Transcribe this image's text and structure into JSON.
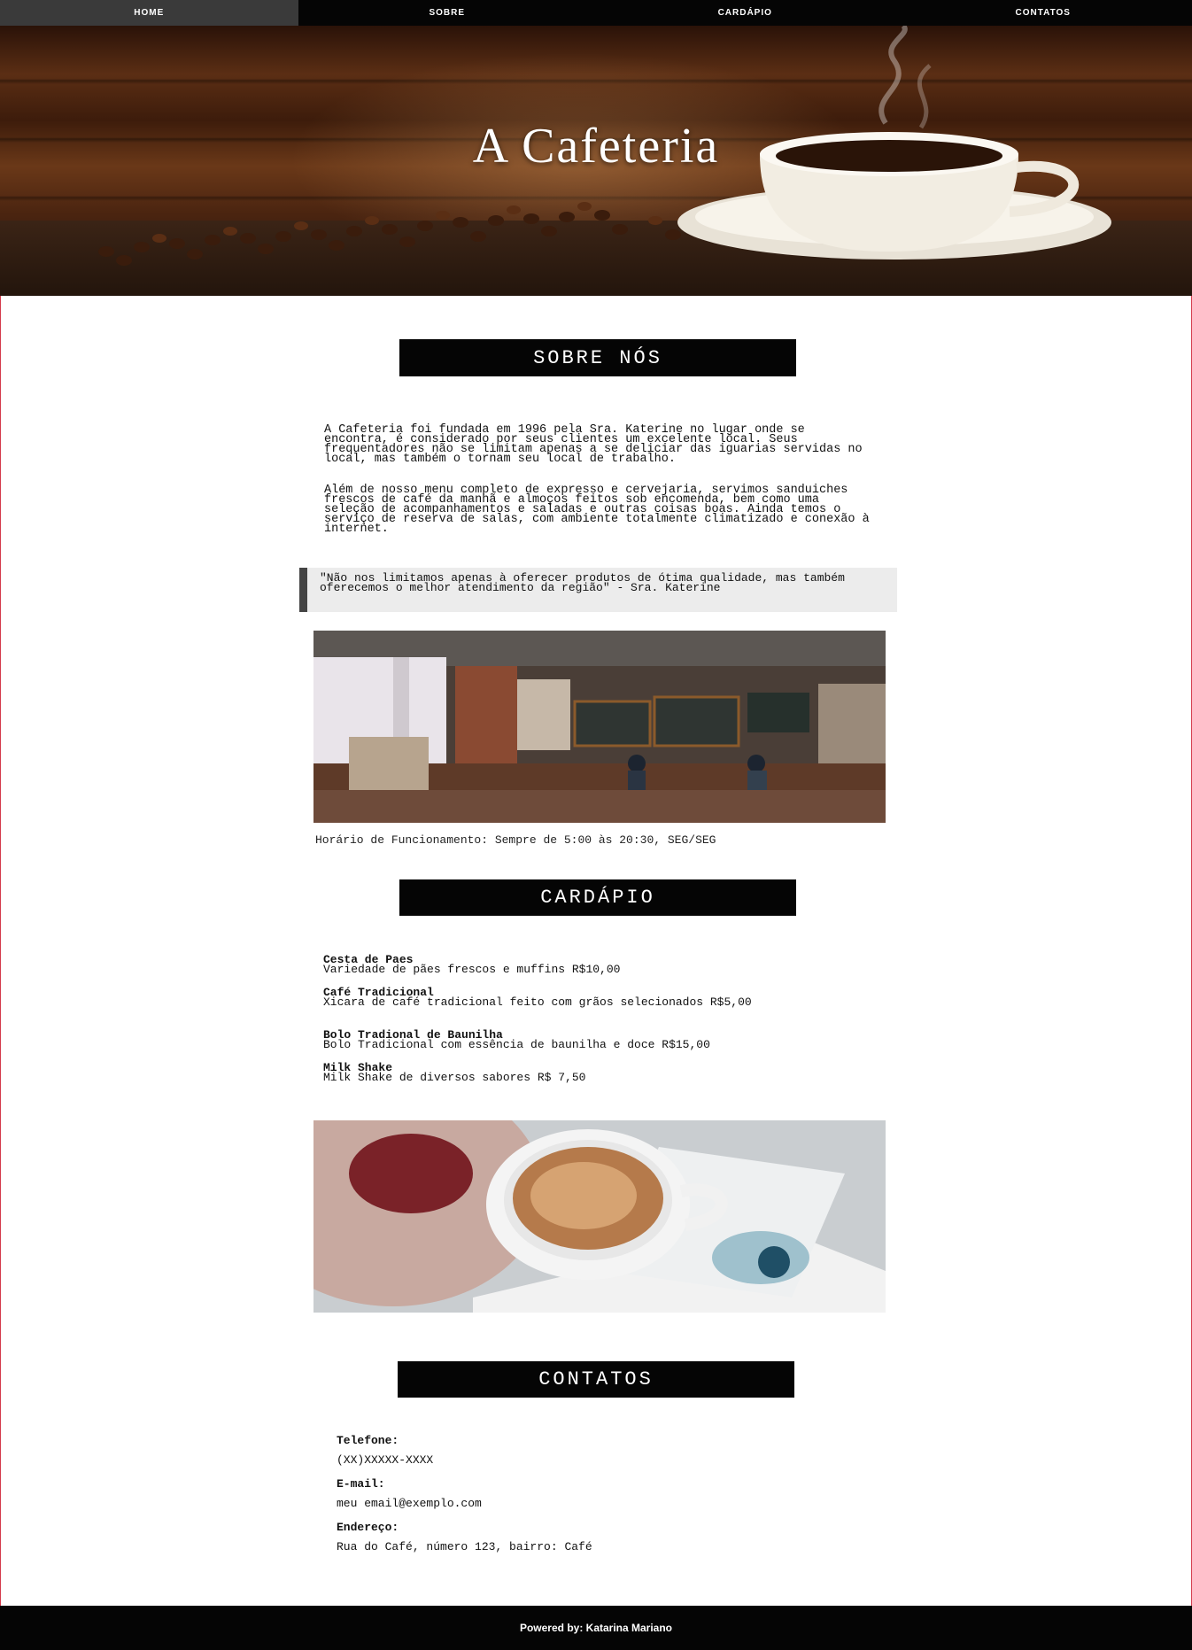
{
  "nav": {
    "items": [
      {
        "label": "HOME"
      },
      {
        "label": "SOBRE"
      },
      {
        "label": "CARDÁPIO"
      },
      {
        "label": "CONTATOS"
      }
    ]
  },
  "hero": {
    "title": "A Cafeteria"
  },
  "about": {
    "heading": "SOBRE NÓS",
    "paragraph1": "A Cafeteria foi fundada em 1996 pela Sra. Katerine no lugar onde se encontra, é considerado por seus clientes um excelente local. Seus frequentadores não se limitam apenas a se deliciar das iguarias servidas no local, mas também o tornam seu local de trabalho.",
    "paragraph2": "Além de nosso menu completo de expresso e cervejaria, servimos sanduiches frescos de café da manhã e almoços feitos sob encomenda, bem como uma seleção de acompanhamentos e saladas e outras coisas boas. Ainda temos o serviço de reserva de salas, com ambiente totalmente climatizado e conexão à internet.",
    "quote": "\"Não nos limitamos apenas à oferecer produtos de ótima qualidade, mas também oferecemos o melhor atendimento da região\" - Sra. Katerine",
    "hours": "Horário de Funcionamento: Sempre de 5:00 às 20:30, SEG/SEG"
  },
  "menu": {
    "heading": "CARDÁPIO",
    "items": [
      {
        "name": "Cesta de Paes",
        "desc": "Variedade de pães frescos e muffins R$10,00"
      },
      {
        "name": "Café Tradicional",
        "desc": "Xicara de café tradicional feito com grãos selecionados R$5,00"
      },
      {
        "name": "Bolo Tradional de Baunilha",
        "desc": "Bolo Tradicional com essência de baunilha e doce R$15,00"
      },
      {
        "name": "Milk Shake",
        "desc": "Milk Shake de diversos sabores R$ 7,50"
      }
    ]
  },
  "contacts": {
    "heading": "CONTATOS",
    "phone_label": "Telefone:",
    "phone": "(XX)XXXXX-XXXX",
    "email_label": "E-mail:",
    "email": "meu email@exemplo.com",
    "address_label": "Endereço:",
    "address": "Rua do Café, número 123, bairro: Café"
  },
  "footer": {
    "text": "Powered by: Katarina Mariano"
  },
  "colors": {
    "nav_bg": "#050505",
    "nav_active": "#3a3a3a",
    "quote_bg": "#ececec",
    "accent_edge": "#d43c4c"
  }
}
